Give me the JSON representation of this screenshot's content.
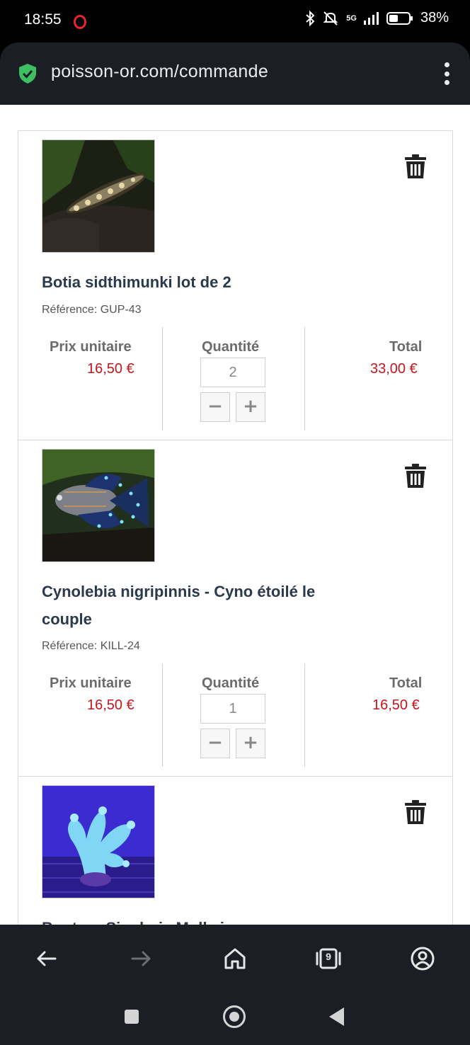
{
  "status_bar": {
    "time": "18:55",
    "network": "5G",
    "battery": "38%"
  },
  "browser": {
    "url": "poisson-or.com/commande"
  },
  "cart": {
    "col_unit_price": "Prix unitaire",
    "col_quantity": "Quantité",
    "col_total": "Total",
    "items": [
      {
        "name": "Botia sidthimunki lot de 2",
        "reference": "Référence: GUP-43",
        "unit_price": "16,50 €",
        "quantity": "2",
        "total": "33,00 €"
      },
      {
        "name": "Cynolebia nigripinnis - Cyno étoilé le couple",
        "reference": "Référence: KILL-24",
        "unit_price": "16,50 €",
        "quantity": "1",
        "total": "16,50 €"
      },
      {
        "name": "Bouture Sinularia Molle jaune"
      }
    ]
  },
  "icons": {
    "trash": "trash-icon",
    "minus": "minus-icon",
    "plus": "plus-icon",
    "back": "arrow-left-icon",
    "forward": "arrow-right-icon",
    "home": "home-icon",
    "tabs": "tabs-icon",
    "account": "account-icon"
  },
  "tab_count": "9",
  "colors": {
    "price_red": "#c5161d",
    "title_navy": "#2a3a4c",
    "secure_green": "#3fbf63",
    "bar_dark": "#1b1f25"
  }
}
